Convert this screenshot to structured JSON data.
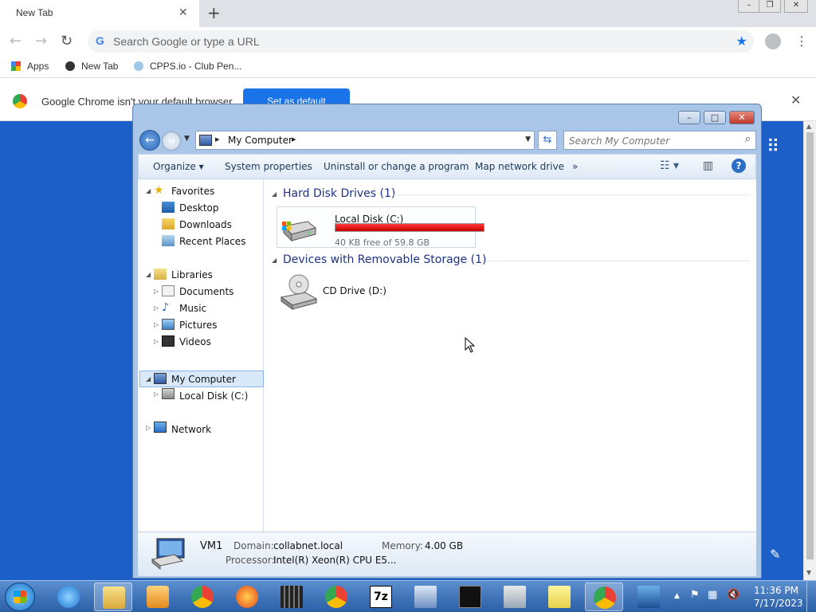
{
  "chrome": {
    "tab_title": "New Tab",
    "omnibox_placeholder": "Search Google or type a URL",
    "bookmarks": [
      "Apps",
      "New Tab",
      "CPPS.io - Club Pen..."
    ],
    "infobar_text": "Google Chrome isn't your default browser",
    "infobar_button": "Set as default"
  },
  "explorer": {
    "address": "My Computer",
    "search_placeholder": "Search My Computer",
    "commands": [
      "Organize",
      "System properties",
      "Uninstall or change a program",
      "Map network drive",
      "»"
    ],
    "nav": {
      "favorites": "Favorites",
      "desktop": "Desktop",
      "downloads": "Downloads",
      "recent": "Recent Places",
      "libraries": "Libraries",
      "documents": "Documents",
      "music": "Music",
      "pictures": "Pictures",
      "videos": "Videos",
      "computer": "My Computer",
      "local_disk": "Local Disk (C:)",
      "network": "Network"
    },
    "groups": {
      "hdd": "Hard Disk Drives (1)",
      "removable": "Devices with Removable Storage (1)"
    },
    "drive_c": {
      "name": "Local Disk (C:)",
      "free_text": "40 KB free of 59.8 GB",
      "used_fraction": 1.0
    },
    "drive_d": {
      "name": "CD Drive (D:)"
    },
    "details": {
      "name": "VM1",
      "domain_label": "Domain:",
      "domain": "collabnet.local",
      "memory_label": "Memory:",
      "memory": "4.00 GB",
      "processor_label": "Processor:",
      "processor": "Intel(R) Xeon(R) CPU E5..."
    }
  },
  "taskbar": {
    "time": "11:36 PM",
    "date": "7/17/2023"
  },
  "colors": {
    "desktop": "#1d5fc9",
    "drive_full": "#d00000",
    "chrome_blue": "#1a73e8"
  }
}
